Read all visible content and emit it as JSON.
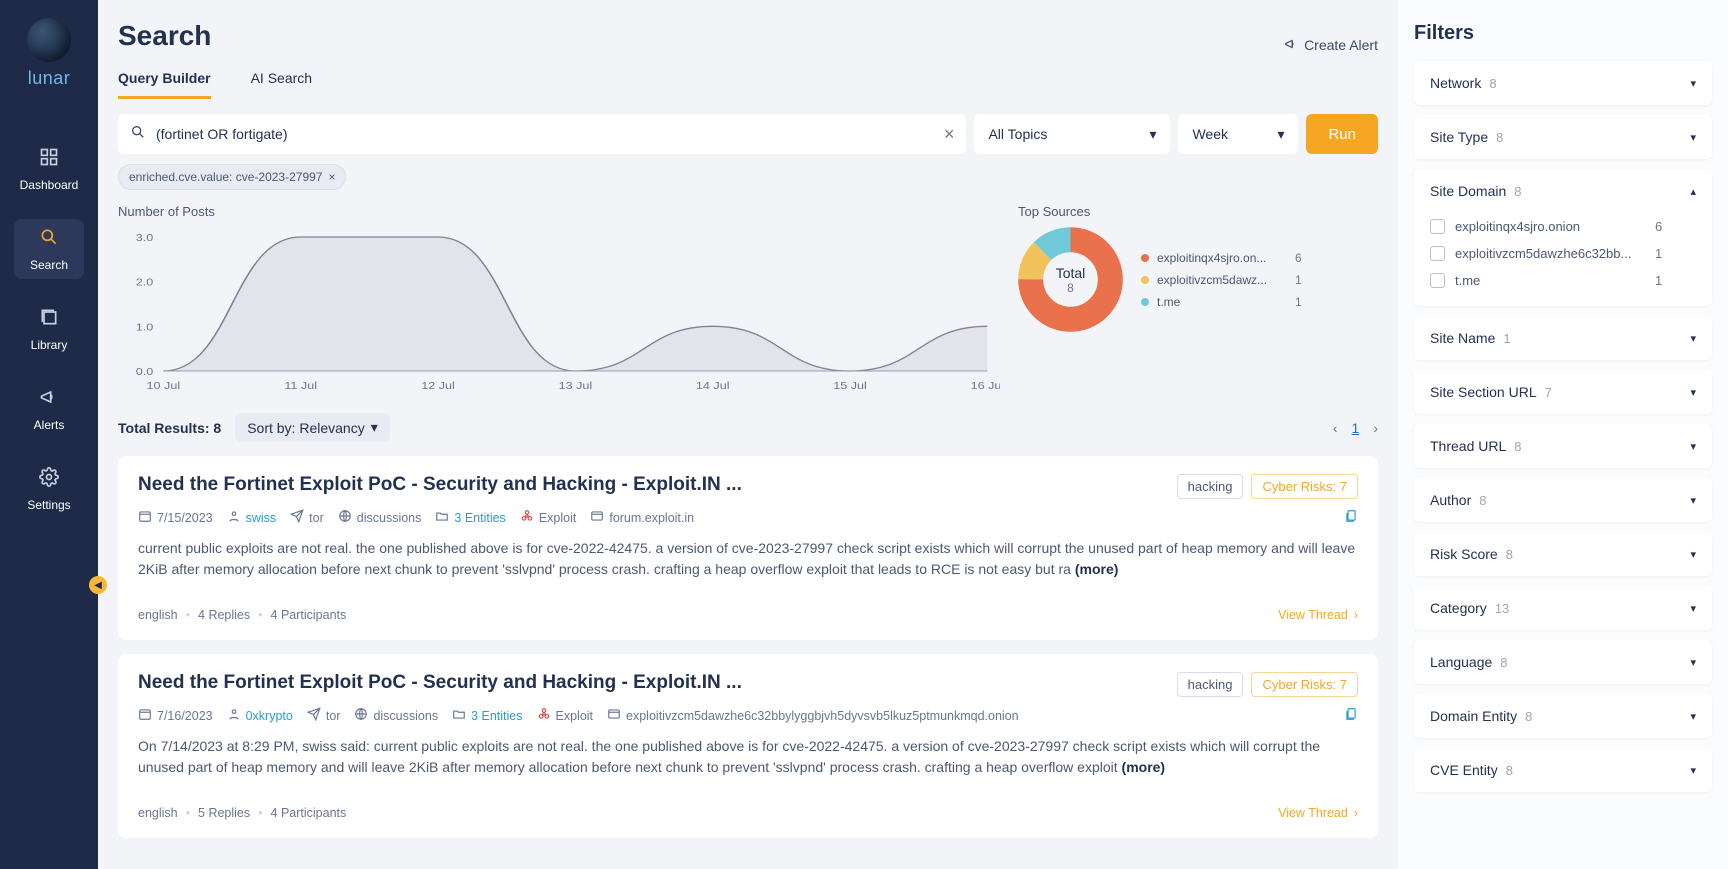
{
  "brand": "lunar",
  "nav": {
    "dashboard": "Dashboard",
    "search": "Search",
    "library": "Library",
    "alerts": "Alerts",
    "settings": "Settings"
  },
  "page": {
    "title": "Search"
  },
  "tabs": {
    "query_builder": "Query Builder",
    "ai_search": "AI Search"
  },
  "create_alert": "Create Alert",
  "query": {
    "text": "(fortinet OR fortigate)",
    "topic": "All Topics",
    "range": "Week",
    "run": "Run",
    "chip": "enriched.cve.value: cve-2023-27997"
  },
  "chart_data": {
    "type": "line",
    "title": "Number of Posts",
    "xlabel": "",
    "ylabel": "",
    "ylim": [
      0,
      3
    ],
    "categories": [
      "10 Jul",
      "11 Jul",
      "12 Jul",
      "13 Jul",
      "14 Jul",
      "15 Jul",
      "16 Jul"
    ],
    "values": [
      0.0,
      3.0,
      3.0,
      0.0,
      1.0,
      0.0,
      1.0
    ]
  },
  "sources": {
    "title": "Top Sources",
    "total_label": "Total",
    "total": 8,
    "items": [
      {
        "label": "exploitinqx4sjro.on...",
        "count": 6,
        "color": "#e9714c"
      },
      {
        "label": "exploitivzcm5dawz...",
        "count": 1,
        "color": "#f2c35c"
      },
      {
        "label": "t.me",
        "count": 1,
        "color": "#6fc9d9"
      }
    ]
  },
  "results": {
    "total_label": "Total Results: 8",
    "sort_label": "Sort by: Relevancy",
    "page": "1",
    "items": [
      {
        "title": "Need the Fortinet Exploit PoC - Security and Hacking - Exploit.IN ...",
        "tag": "hacking",
        "risk": "Cyber Risks: 7",
        "date": "7/15/2023",
        "author": "swiss",
        "net": "tor",
        "section": "discussions",
        "entities": "3 Entities",
        "exploit": "Exploit",
        "domain": "forum.exploit.in",
        "snippet": "current public exploits are not real. the one published above is for cve-2022-42475. a version of cve-2023-27997 check script exists which will corrupt the unused part of heap memory and will leave 2KiB after memory allocation before next chunk to prevent 'sslvpnd' process crash. crafting a heap overflow exploit that leads to RCE is not easy but ra ",
        "more": "(more)",
        "lang": "english",
        "replies": "4 Replies",
        "participants": "4 Participants",
        "view": "View Thread"
      },
      {
        "title": "Need the Fortinet Exploit PoC - Security and Hacking - Exploit.IN ...",
        "tag": "hacking",
        "risk": "Cyber Risks: 7",
        "date": "7/16/2023",
        "author": "0xkrypto",
        "net": "tor",
        "section": "discussions",
        "entities": "3 Entities",
        "exploit": "Exploit",
        "domain": "exploitivzcm5dawzhe6c32bbylyggbjvh5dyvsvb5lkuz5ptmunkmqd.onion",
        "snippet": "On 7/14/2023 at 8:29 PM, swiss said: current public exploits are not real. the one published above is for cve-2022-42475. a version of cve-2023-27997 check script exists which will corrupt the unused part of heap memory and will leave 2KiB after memory allocation before next chunk to prevent 'sslvpnd' process crash. crafting a heap overflow exploit ",
        "more": "(more)",
        "lang": "english",
        "replies": "5 Replies",
        "participants": "4 Participants",
        "view": "View Thread"
      }
    ]
  },
  "filters": {
    "title": "Filters",
    "groups": [
      {
        "name": "Network",
        "count": 8,
        "open": false
      },
      {
        "name": "Site Type",
        "count": 8,
        "open": false
      },
      {
        "name": "Site Domain",
        "count": 8,
        "open": true,
        "options": [
          {
            "label": "exploitinqx4sjro.onion",
            "count": 6
          },
          {
            "label": "exploitivzcm5dawzhe6c32bb...",
            "count": 1
          },
          {
            "label": "t.me",
            "count": 1
          }
        ]
      },
      {
        "name": "Site Name",
        "count": 1,
        "open": false
      },
      {
        "name": "Site Section URL",
        "count": 7,
        "open": false
      },
      {
        "name": "Thread URL",
        "count": 8,
        "open": false
      },
      {
        "name": "Author",
        "count": 8,
        "open": false
      },
      {
        "name": "Risk Score",
        "count": 8,
        "open": false
      },
      {
        "name": "Category",
        "count": 13,
        "open": false
      },
      {
        "name": "Language",
        "count": 8,
        "open": false
      },
      {
        "name": "Domain Entity",
        "count": 8,
        "open": false
      },
      {
        "name": "CVE Entity",
        "count": 8,
        "open": false
      }
    ]
  }
}
